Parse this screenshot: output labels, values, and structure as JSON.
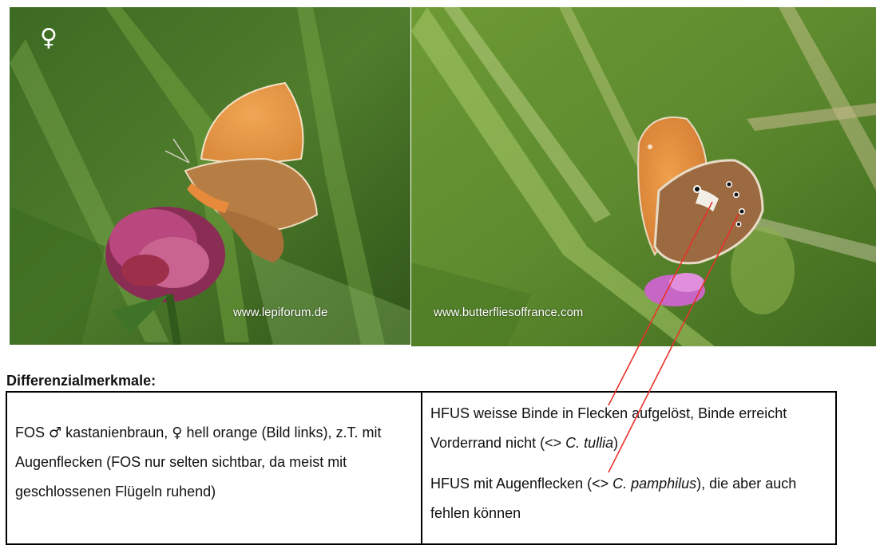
{
  "photos": {
    "left": {
      "sex_symbol": "♀",
      "credit": "www.lepiforum.de"
    },
    "right": {
      "credit": "www.butterfliesoffrance.com"
    }
  },
  "heading": "Differenzialmerkmale:",
  "table": {
    "left_cell": {
      "seg1": "FOS ",
      "male": "♂",
      "seg2": " kastanienbraun, ",
      "female": "♀",
      "seg3": " hell orange (Bild links), z.T. mit Augenflecken (FOS nur selten sichtbar, da meist mit geschlossenen Flügeln ruhend)"
    },
    "right_cell": {
      "para1_text": "HFUS weisse Binde in Flecken aufgelöst, Binde erreicht Vorderrand nicht (<> ",
      "para1_species": "C. tullia",
      "para1_end": ")",
      "para2_text": "HFUS mit Augenflecken (<> ",
      "para2_species": "C. pamphilus",
      "para2_end": "), die aber auch fehlen können"
    }
  },
  "colors": {
    "pointer_line": "#e8312a",
    "wing_orange": "#e59a45",
    "grass_green": "#5d8a2e"
  }
}
